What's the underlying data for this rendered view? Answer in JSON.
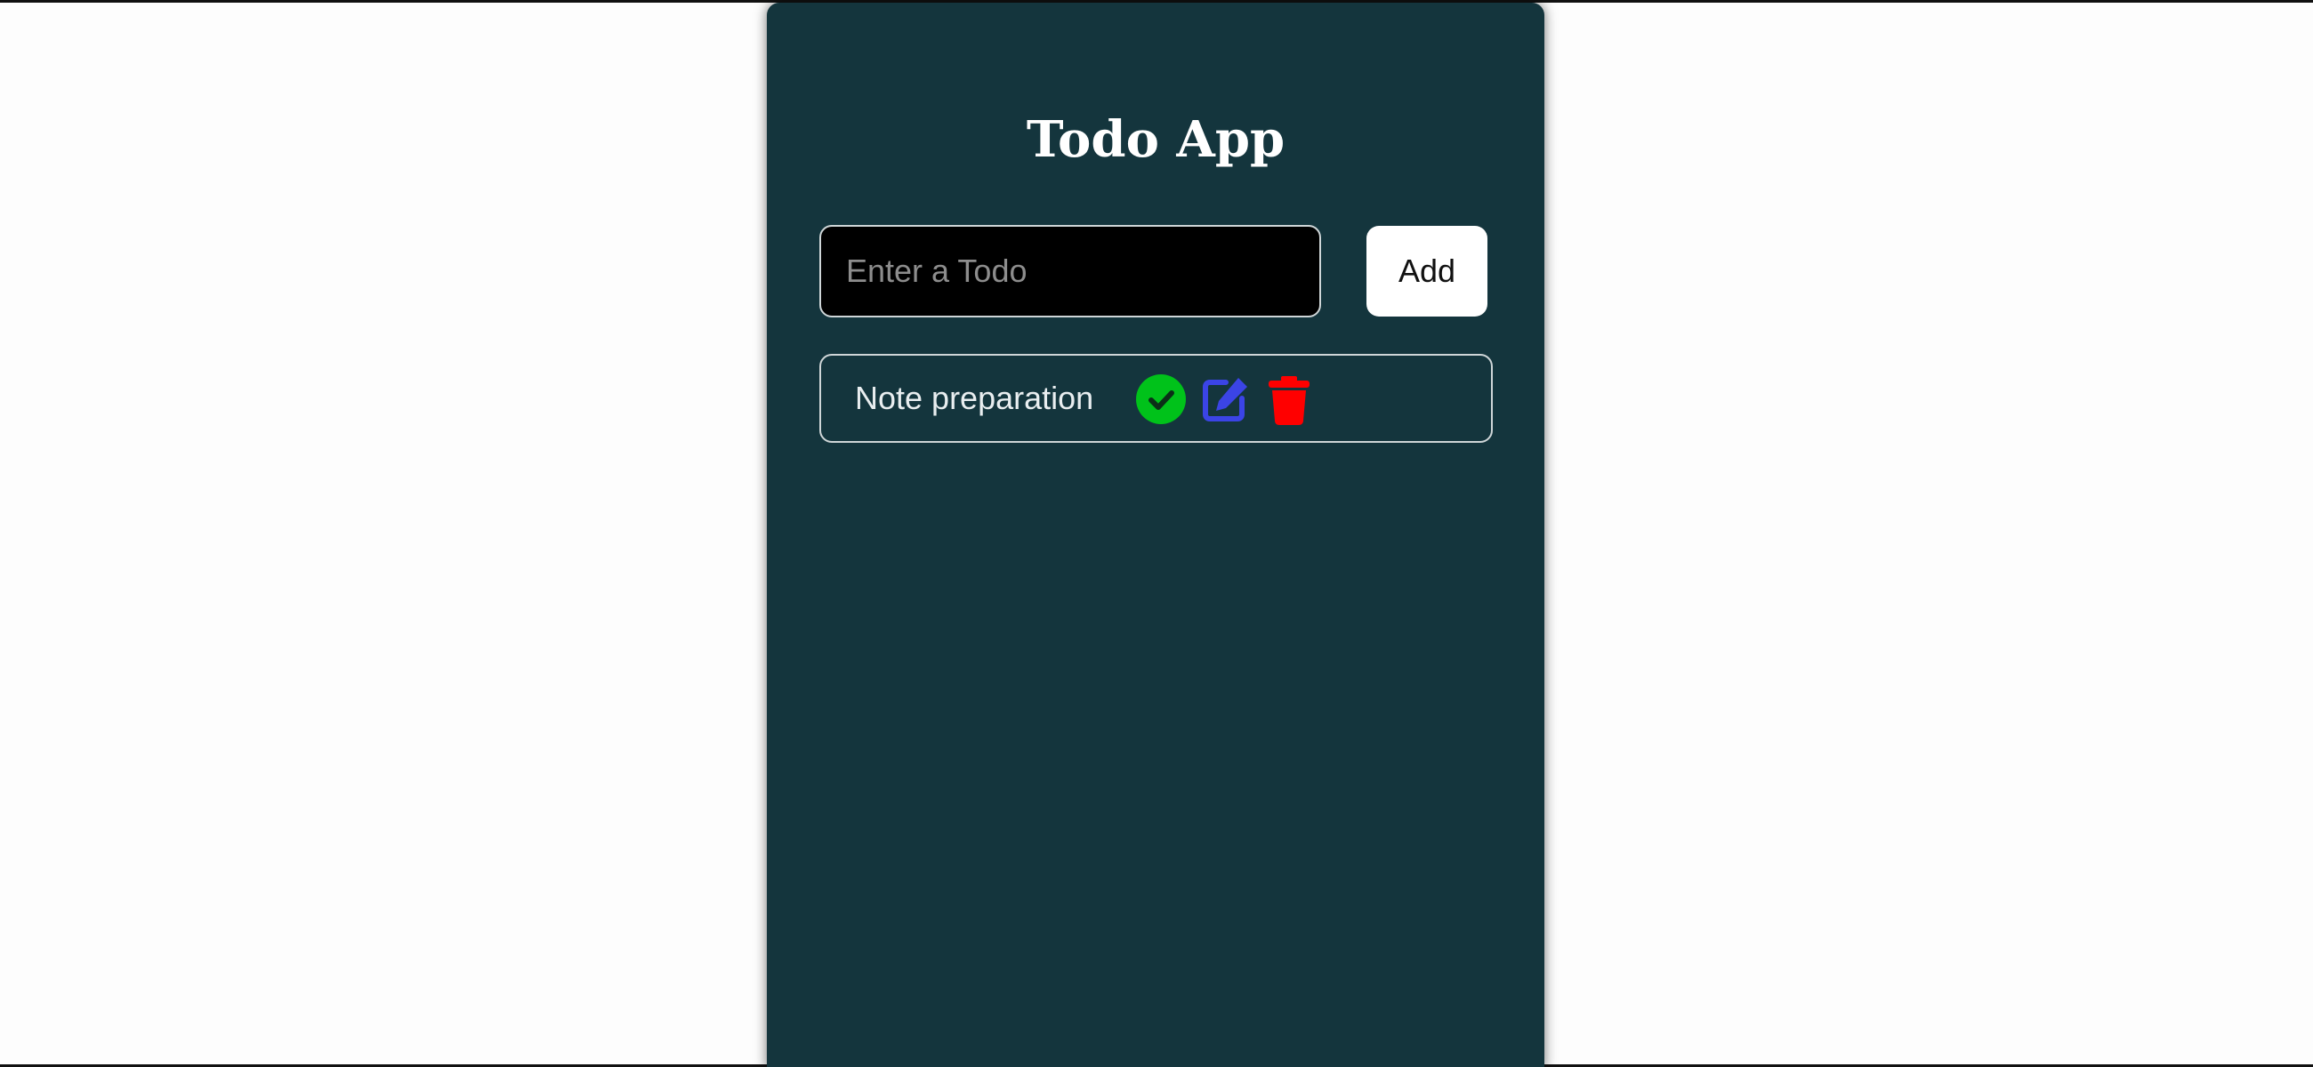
{
  "app": {
    "title": "Todo App"
  },
  "form": {
    "input_value": "",
    "input_placeholder": "Enter a Todo",
    "add_label": "Add"
  },
  "todos": [
    {
      "text": "Note preparation",
      "actions": {
        "complete_icon": "check-circle-icon",
        "edit_icon": "edit-icon",
        "delete_icon": "trash-icon"
      }
    }
  ],
  "colors": {
    "card_background": "#14353d",
    "complete": "#00c21a",
    "edit": "#3b44e6",
    "delete": "#ff0000"
  }
}
